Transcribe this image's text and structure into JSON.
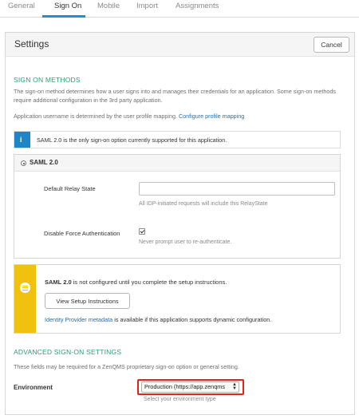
{
  "tabs": [
    {
      "label": "General"
    },
    {
      "label": "Sign On"
    },
    {
      "label": "Mobile"
    },
    {
      "label": "Import"
    },
    {
      "label": "Assignments"
    }
  ],
  "settings": {
    "title": "Settings",
    "cancel_label": "Cancel"
  },
  "sign_on": {
    "section_title": "SIGN ON METHODS",
    "description": "The sign-on method determines how a user signs into and manages their credentials for an application. Some sign-on methods require additional configuration in the 3rd party application.",
    "username_text": "Application username is determined by the user profile mapping.",
    "configure_link": "Configure profile mapping",
    "info_text": "SAML 2.0 is the only sign-on option currently supported for this application.",
    "saml_label": "SAML 2.0",
    "relay_label": "Default Relay State",
    "relay_value": "",
    "relay_hint": "All IDP-initiated requests will include this RelayState",
    "force_auth_label": "Disable Force Authentication",
    "force_auth_checked": true,
    "force_auth_hint": "Never prompt user to re-authenticate.",
    "warning_bold": "SAML 2.0",
    "warning_text": " is not configured until you complete the setup instructions.",
    "setup_button": "View Setup Instructions",
    "idp_link": "Identity Provider metadata",
    "idp_text": " is available if this application supports dynamic configuration."
  },
  "advanced": {
    "section_title": "ADVANCED SIGN-ON SETTINGS",
    "description": "These fields may be required for a ZenQMS proprietary sign-on option or general setting.",
    "environment_label": "Environment",
    "environment_value": "Production (https://app.zenqms",
    "environment_hint": "Select your environment type"
  },
  "colors": {
    "accent_tab": "#1e8fd6",
    "section_title": "#2a9d77",
    "info_strip": "#1e86c7",
    "warning_strip": "#f0c20f",
    "highlight": "#e0241b",
    "link": "#1e6fb0"
  }
}
